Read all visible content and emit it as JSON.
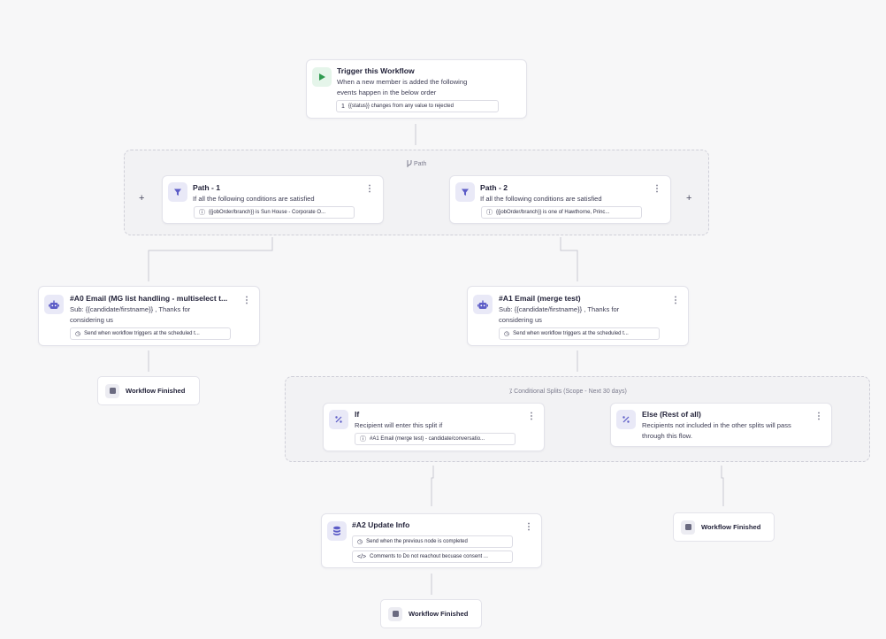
{
  "trigger": {
    "icon": "play-icon",
    "title": "Trigger this Workflow",
    "desc_line1": "When a new member is added the following",
    "desc_line2": "events happen in the below order",
    "chip_num": "1",
    "chip_text": "{{status}} changes from any value to rejected"
  },
  "path_group": {
    "label": "Path",
    "add_left": "+",
    "add_right": "+",
    "paths": [
      {
        "title": "Path - 1",
        "desc": "If all the following conditions are satisfied",
        "chip": "{{jobOrder/branch}} is Sun House - Corporate O..."
      },
      {
        "title": "Path - 2",
        "desc": "If all the following conditions are satisfied",
        "chip": "{{jobOrder/branch}} is one of Hawthorne, Princ..."
      }
    ]
  },
  "emails": [
    {
      "title": "#A0 Email (MG list handling - multiselect t...",
      "desc_line1": "Sub: {{candidate/firstname}} , Thanks for",
      "desc_line2": "considering us",
      "chip": "Send when workflow triggers at the scheduled t..."
    },
    {
      "title": "#A1 Email (merge test)",
      "desc_line1": "Sub: {{candidate/firstname}} , Thanks for",
      "desc_line2": "considering us",
      "chip": "Send when workflow triggers at the scheduled t..."
    }
  ],
  "finished_label": "Workflow Finished",
  "splits": {
    "label": "Conditional Splits (Scope - Next 30 days)",
    "if": {
      "title": "If",
      "desc": "Recipient will enter this split if",
      "chip": "#A1 Email (merge test) - candidate/conversatio..."
    },
    "else": {
      "title": "Else (Rest of all)",
      "desc_line1": "Recipients not included in the other splits will pass",
      "desc_line2": "through this flow."
    }
  },
  "update": {
    "title": "#A2 Update Info",
    "chip1": "Send when the previous node is completed",
    "chip2": "Comments to Do not reachout becuase consent ..."
  },
  "colors": {
    "accent": "#5c5cc7",
    "trigger_green": "#2e9a4f"
  }
}
